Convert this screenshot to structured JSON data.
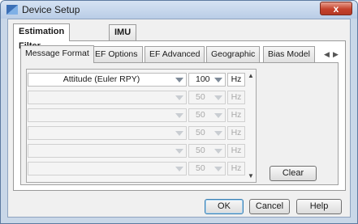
{
  "window": {
    "title": "Device Setup",
    "close_glyph": "x"
  },
  "outer_tabs": [
    {
      "label": "Estimation Filter",
      "active": true
    },
    {
      "label": "IMU",
      "active": false
    }
  ],
  "inner_tabs": [
    {
      "label": "Message Format",
      "active": true
    },
    {
      "label": "EF Options",
      "active": false
    },
    {
      "label": "EF Advanced",
      "active": false
    },
    {
      "label": "Geographic",
      "active": false
    },
    {
      "label": "Bias Model",
      "active": false
    }
  ],
  "tab_scroll": {
    "left_glyph": "◀",
    "right_glyph": "▶"
  },
  "message_rows": [
    {
      "type": "Attitude (Euler RPY)",
      "rate": "100",
      "unit": "Hz",
      "enabled": true
    },
    {
      "type": "",
      "rate": "50",
      "unit": "Hz",
      "enabled": false
    },
    {
      "type": "",
      "rate": "50",
      "unit": "Hz",
      "enabled": false
    },
    {
      "type": "",
      "rate": "50",
      "unit": "Hz",
      "enabled": false
    },
    {
      "type": "",
      "rate": "50",
      "unit": "Hz",
      "enabled": false
    },
    {
      "type": "",
      "rate": "50",
      "unit": "Hz",
      "enabled": false
    }
  ],
  "scrollbar": {
    "up_glyph": "▲",
    "down_glyph": "▼"
  },
  "buttons": {
    "clear": "Clear",
    "ok": "OK",
    "cancel": "Cancel",
    "help": "Help"
  },
  "colors": {
    "title_bar": "#c9d7e8",
    "close_button": "#c5412b",
    "default_button_border": "#3c7fb1"
  }
}
